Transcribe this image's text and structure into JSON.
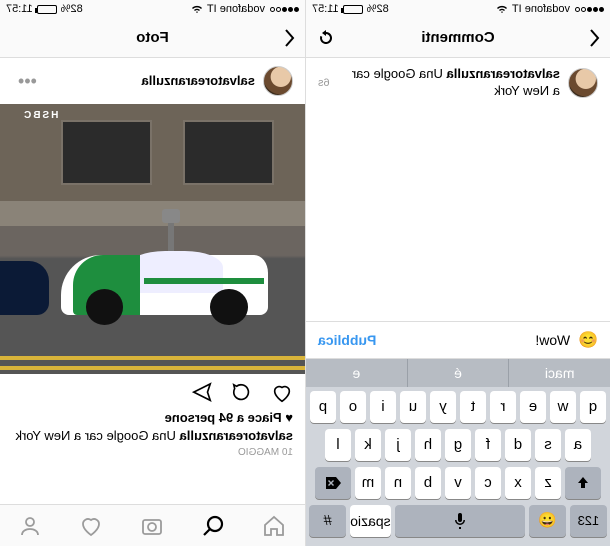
{
  "status": {
    "carrier": "vodafone IT",
    "battery_pct": "82%",
    "time": "11:57"
  },
  "left": {
    "nav_title": "Commenti",
    "comment": {
      "username": "salvatorearanzulla",
      "caption": "Una Google car a New York",
      "age": "6s"
    },
    "input": {
      "value": "Wow!",
      "publish": "Pubblica"
    },
    "suggestions": [
      "maci",
      "é",
      "e"
    ],
    "keyboard": {
      "row1": [
        "q",
        "w",
        "e",
        "r",
        "t",
        "y",
        "u",
        "i",
        "o",
        "p"
      ],
      "row2": [
        "a",
        "s",
        "d",
        "f",
        "g",
        "h",
        "j",
        "k",
        "l"
      ],
      "row3": [
        "z",
        "x",
        "c",
        "v",
        "b",
        "n",
        "m"
      ],
      "mode_key": "123",
      "space": "spazio",
      "num_key": "#"
    }
  },
  "right": {
    "nav_title": "Foto",
    "post": {
      "username": "salvatorearanzulla",
      "likes_text": "Piace a 94 persone",
      "caption_user": "salvatorearanzulla",
      "caption_text": "Una Google car a New York",
      "date": "10 MAGGIO",
      "building_sign": "HSBC"
    }
  }
}
